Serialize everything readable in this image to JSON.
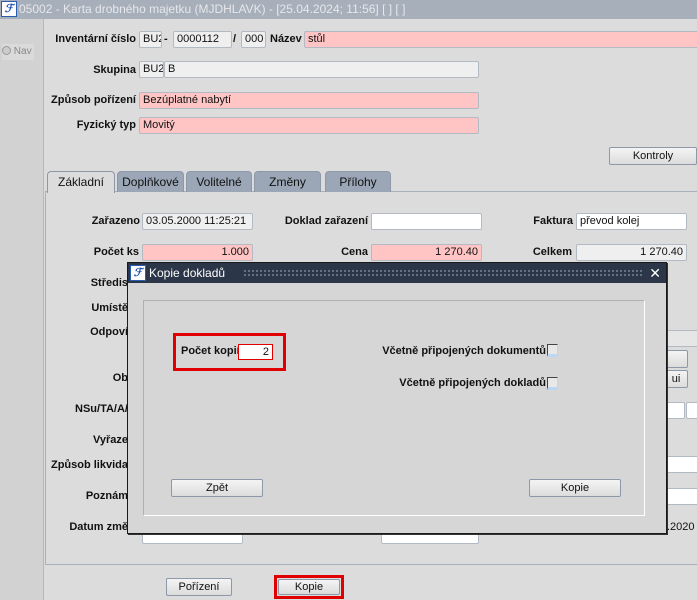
{
  "window": {
    "title": "05002 - Karta drobného majetku (MJDHLAVK) - [25.04.2024; 11:56]  [ ]  [ ]",
    "icon": "app-logo-icon"
  },
  "nav": {
    "label": "Nav"
  },
  "header": {
    "inv_label": "Inventární číslo",
    "inv_prefix": "BU2",
    "inv_sep1": "-",
    "inv_number": "0000112",
    "inv_sep2": "/",
    "inv_suffix": "000",
    "nazev_label": "Název",
    "nazev_value": "stůl",
    "skupina_label": "Skupina",
    "skupina_code": "BU2",
    "skupina_value": "B",
    "zpusob_label": "Způsob pořízení",
    "zpusob_value": "Bezúplatné nabytí",
    "typ_label": "Fyzický typ",
    "typ_value": "Movitý",
    "kontroly": "Kontroly"
  },
  "tabs": [
    {
      "label": "Základní",
      "active": true
    },
    {
      "label": "Doplňkové"
    },
    {
      "label": "Volitelné"
    },
    {
      "label": "Změny"
    },
    {
      "label": "Přílohy"
    }
  ],
  "basic": {
    "zarazeno_label": "Zařazeno",
    "zarazeno_value": "03.05.2000 11:25:21",
    "doklad_label": "Doklad zařazení",
    "doklad_value": "",
    "faktura_label": "Faktura",
    "faktura_value": "převod kolej",
    "pocet_label": "Počet ks",
    "pocet_value": "1.000",
    "cena_label": "Cena",
    "cena_value": "1 270.40",
    "celkem_label": "Celkem",
    "celkem_value": "1 270.40",
    "partial_labels": [
      "Středis",
      "Umístě",
      "Odpoví",
      "Ob",
      "NSu/TA/A/",
      "Vyřaze",
      "Způsob likvida",
      "Poznám",
      "Datum změ"
    ],
    "partial_button": "ui",
    "partial_date": ".2020"
  },
  "footer": {
    "porizeni": "Pořízení",
    "kopie": "Kopie"
  },
  "dialog": {
    "title": "Kopie dokladů",
    "pocet_label": "Počet kopií",
    "pocet_value": "2",
    "dokumenty_label": "Včetně připojených dokumentů",
    "dokumenty_checked": false,
    "doklady_label": "Včetně připojených dokladů",
    "doklady_checked": false,
    "back": "Zpět",
    "copy": "Kopie"
  },
  "colors": {
    "required": "#ffc4c4",
    "highlight": "#e00000",
    "dialog_title": "#2c3649"
  }
}
